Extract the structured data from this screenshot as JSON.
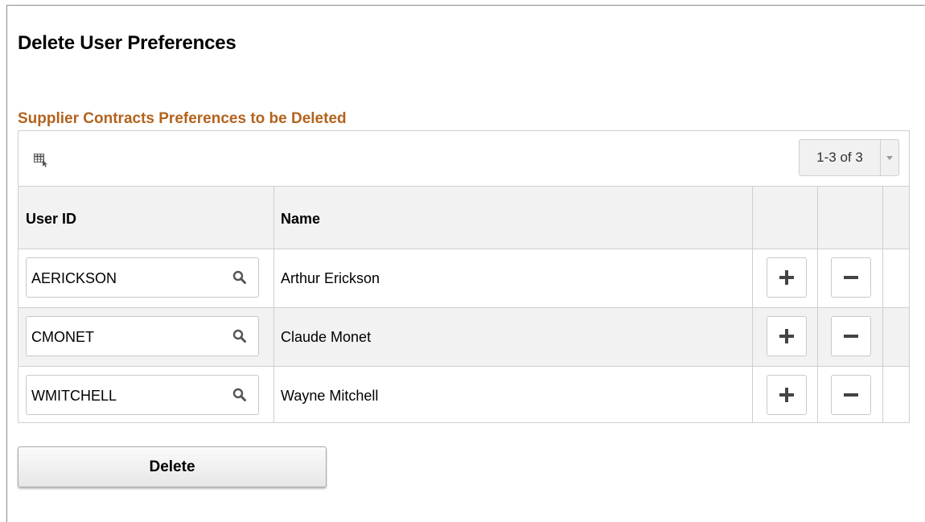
{
  "page": {
    "title": "Delete User Preferences"
  },
  "section": {
    "title": "Supplier Contracts Preferences to be Deleted"
  },
  "grid": {
    "pager_label": "1-3 of 3",
    "columns": {
      "user_id": "User ID",
      "name": "Name"
    },
    "rows": [
      {
        "user_id": "AERICKSON",
        "name": "Arthur Erickson"
      },
      {
        "user_id": "CMONET",
        "name": "Claude Monet"
      },
      {
        "user_id": "WMITCHELL",
        "name": "Wayne Mitchell"
      }
    ]
  },
  "actions": {
    "delete_label": "Delete"
  },
  "icons": {
    "grid_options": "grid-personalize-icon",
    "lookup": "search-icon",
    "add_row": "plus-icon",
    "delete_row": "minus-icon",
    "pager_dropdown": "chevron-down-icon"
  },
  "colors": {
    "section_title": "#b3631d",
    "header_bg": "#f2f2f2",
    "border": "#cfcfcf"
  }
}
